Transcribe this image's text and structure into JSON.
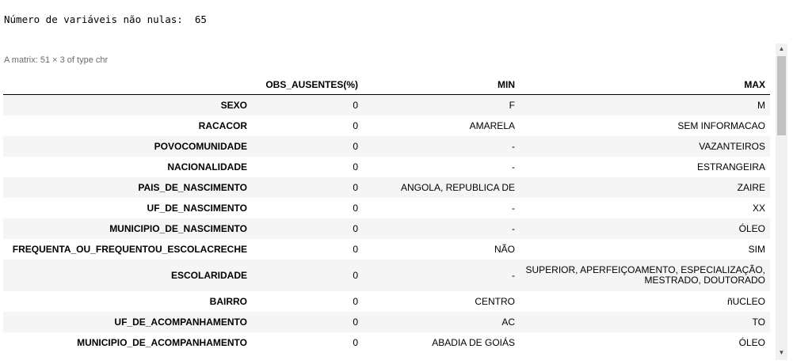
{
  "stdout_text": "Número de variáveis não nulas:  65",
  "caption": "A matrix: 51 × 3 of type chr",
  "headers": [
    "",
    "OBS_AUSENTES(%)",
    "MIN",
    "MAX"
  ],
  "rows": [
    {
      "name": "SEXO",
      "obs": "0",
      "min": "F",
      "max": "M"
    },
    {
      "name": "RACACOR",
      "obs": "0",
      "min": "AMARELA",
      "max": "SEM INFORMACAO"
    },
    {
      "name": "POVOCOMUNIDADE",
      "obs": "0",
      "min": "-",
      "max": "VAZANTEIROS"
    },
    {
      "name": "NACIONALIDADE",
      "obs": "0",
      "min": "-",
      "max": "ESTRANGEIRA"
    },
    {
      "name": "PAIS_DE_NASCIMENTO",
      "obs": "0",
      "min": "ANGOLA, REPUBLICA DE",
      "max": "ZAIRE"
    },
    {
      "name": "UF_DE_NASCIMENTO",
      "obs": "0",
      "min": "-",
      "max": "XX"
    },
    {
      "name": "MUNICIPIO_DE_NASCIMENTO",
      "obs": "0",
      "min": "-",
      "max": "ÓLEO"
    },
    {
      "name": "FREQUENTA_OU_FREQUENTOU_ESCOLACRECHE",
      "obs": "0",
      "min": "NÃO",
      "max": "SIM"
    },
    {
      "name": "ESCOLARIDADE",
      "obs": "0",
      "min": "-",
      "max": "SUPERIOR, APERFEIÇOAMENTO, ESPECIALIZAÇÃO, MESTRADO, DOUTORADO"
    },
    {
      "name": "BAIRRO",
      "obs": "0",
      "min": "CENTRO",
      "max": "ñUCLEO"
    },
    {
      "name": "UF_DE_ACOMPANHAMENTO",
      "obs": "0",
      "min": "AC",
      "max": "TO"
    },
    {
      "name": "MUNICIPIO_DE_ACOMPANHAMENTO",
      "obs": "0",
      "min": "ABADIA DE GOIÁS",
      "max": "ÓLEO"
    }
  ],
  "scrollbar": {
    "up_icon": "▲",
    "down_icon": "▼"
  }
}
